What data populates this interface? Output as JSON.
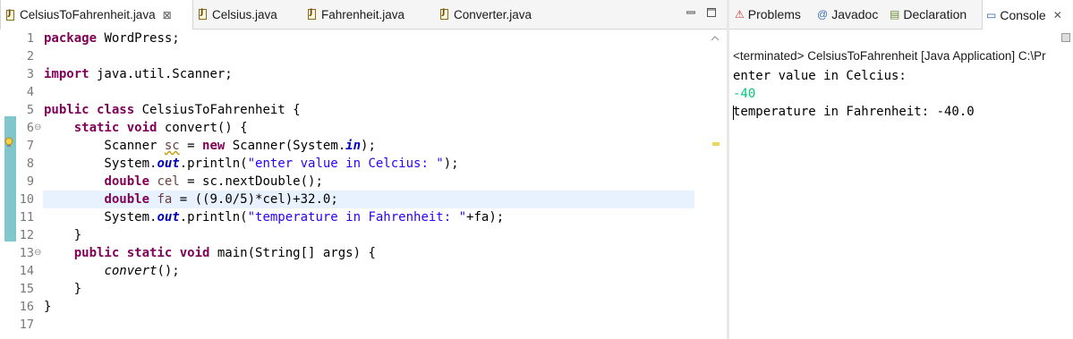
{
  "editor": {
    "tabs": [
      {
        "label": "CelsiusToFahrenheit.java",
        "active": true,
        "close": "⊠"
      },
      {
        "label": "Celsius.java"
      },
      {
        "label": "Fahrenheit.java"
      },
      {
        "label": "Converter.java"
      }
    ],
    "line_numbers": [
      "1",
      "2",
      "3",
      "4",
      "5",
      "6",
      "7",
      "8",
      "9",
      "10",
      "11",
      "12",
      "13",
      "14",
      "15",
      "16",
      "17"
    ],
    "code": {
      "l1_kw": "package",
      "l1_rest": " WordPress;",
      "l3_kw": "import",
      "l3_rest": " java.util.Scanner;",
      "l5_kw": "public class",
      "l5_rest": " CelsiusToFahrenheit {",
      "l6_indent": "    ",
      "l6_kw": "static void",
      "l6_rest": " convert() {",
      "l7_a": "        Scanner ",
      "l7_var": "sc",
      "l7_b": " = ",
      "l7_kw": "new",
      "l7_c": " Scanner(System.",
      "l7_fld": "in",
      "l7_d": ");",
      "l8_a": "        System.",
      "l8_fld": "out",
      "l8_b": ".println(",
      "l8_str": "\"enter value in Celcius: \"",
      "l8_c": ");",
      "l9_a": "        ",
      "l9_kw": "double",
      "l9_b": " ",
      "l9_var": "cel",
      "l9_c": " = sc.nextDouble();",
      "l10_a": "        ",
      "l10_kw": "double",
      "l10_b": " ",
      "l10_var": "fa",
      "l10_c": " = ((9.0/5)*cel)+32.0;",
      "l11_a": "        System.",
      "l11_fld": "out",
      "l11_b": ".println(",
      "l11_str": "\"temperature in Fahrenheit: \"",
      "l11_c": "+fa);",
      "l12": "    }",
      "l13_indent": "    ",
      "l13_kw": "public static void",
      "l13_rest": " main(String[] args) {",
      "l14_a": "        ",
      "l14_call": "convert",
      "l14_b": "();",
      "l15": "    }",
      "l16": "}"
    },
    "fold_marker": "⊖"
  },
  "views": {
    "tabs": [
      {
        "label": "Problems",
        "icon": "problems-icon",
        "glyph": "⚠"
      },
      {
        "label": "Javadoc",
        "icon": "at-icon",
        "glyph": "@"
      },
      {
        "label": "Declaration",
        "icon": "declaration-icon",
        "glyph": "▤"
      },
      {
        "label": "Console",
        "icon": "console-icon",
        "glyph": "▭",
        "active": true,
        "close": "✕"
      }
    ]
  },
  "console": {
    "header": "<terminated> CelsiusToFahrenheit [Java Application] C:\\Pr",
    "output": [
      {
        "text": "enter value in Celcius:",
        "color": "#000000"
      },
      {
        "text": "-40",
        "color": "#00c87a"
      },
      {
        "text": "temperature in Fahrenheit: -40.0",
        "color": "#000000"
      }
    ]
  },
  "colors": {
    "keyword": "#7f0055",
    "string": "#2a00ff",
    "field": "#0000c0",
    "current_line": "#e8f2fe",
    "change_ruler": "#6cbcc4",
    "stdin": "#00c87a"
  }
}
